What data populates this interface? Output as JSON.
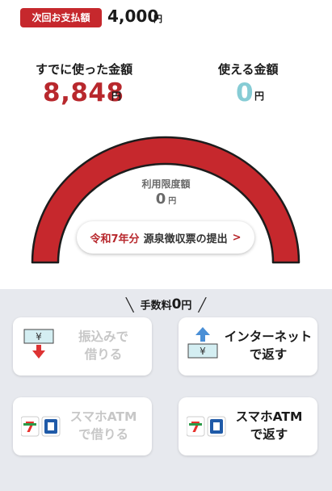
{
  "next_payment": {
    "label": "次回お支払額",
    "amount": "4,000",
    "unit": "円"
  },
  "spent": {
    "label": "すでに使った金額",
    "amount": "8,848",
    "unit": "円"
  },
  "available": {
    "label": "使える金額",
    "amount": "0",
    "unit": "円"
  },
  "limit": {
    "label": "利用限度額",
    "amount": "0",
    "unit": "円"
  },
  "tax_receipt": {
    "year": "令和7年分",
    "text": "源泉徴収票の提出",
    "chevron": ">"
  },
  "fee": {
    "label": "手数料",
    "amount": "0",
    "unit": "円"
  },
  "actions": [
    {
      "line1": "振込みで",
      "line2": "借りる",
      "enabled": false
    },
    {
      "line1": "インターネット",
      "line2": "で返す",
      "enabled": true
    },
    {
      "line1": "スマホATM",
      "line2": "で借りる",
      "enabled": false
    },
    {
      "line1": "スマホATM",
      "line2": "で返す",
      "enabled": true
    }
  ],
  "colors": {
    "brand_red": "#c6282d",
    "available_teal": "#86ccd5",
    "disabled_text": "#c7c7c7",
    "panel_bg": "#e7e9ee"
  }
}
